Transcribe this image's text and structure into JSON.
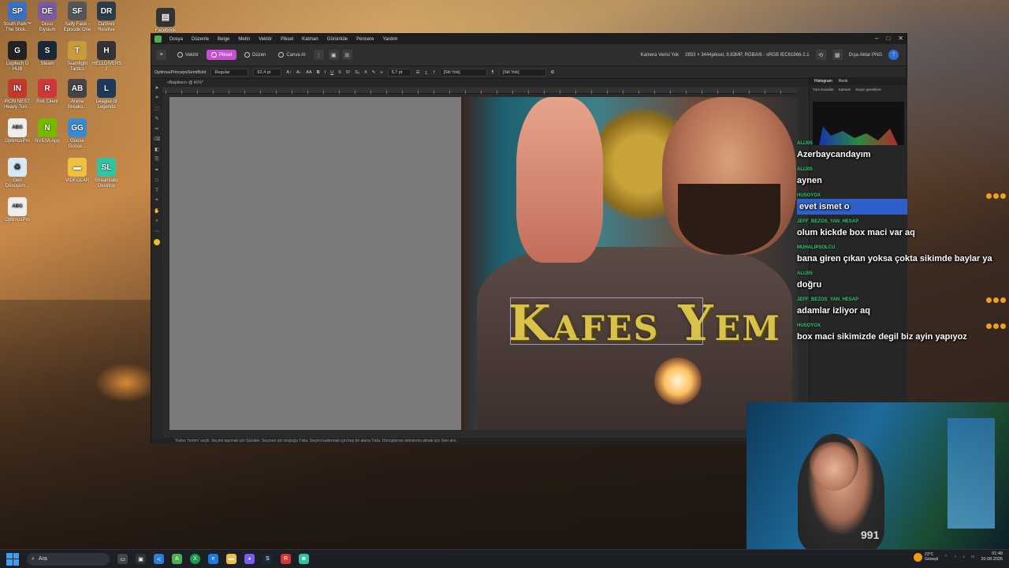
{
  "desktop": {
    "icons": [
      {
        "label": "South Park™ The Stick...",
        "glyph": "SP",
        "color": "#3b6fc0"
      },
      {
        "label": "Disco Elysium",
        "glyph": "DE",
        "color": "#7a5aa0"
      },
      {
        "label": "Sally Face - Episode One",
        "glyph": "SF",
        "color": "#555"
      },
      {
        "label": "DaVinci Resolve",
        "glyph": "DR",
        "color": "#2b3c4a"
      },
      {
        "label": "Logitech G HUB",
        "glyph": "G",
        "color": "#222"
      },
      {
        "label": "Steam",
        "glyph": "S",
        "color": "#1b2838"
      },
      {
        "label": "Teamfight Tactics",
        "glyph": "T",
        "color": "#c89b3c"
      },
      {
        "label": "HELLDIVERS 2",
        "glyph": "H",
        "color": "#333"
      },
      {
        "label": "IRON NEST: Heavy Turr...",
        "glyph": "IN",
        "color": "#c0392b"
      },
      {
        "label": "Riot Client",
        "glyph": "R",
        "color": "#d13639"
      },
      {
        "label": "Arena Breako...",
        "glyph": "AB",
        "color": "#444"
      },
      {
        "label": "League of Legends",
        "glyph": "L",
        "color": "#1e3a5a"
      },
      {
        "label": "OptimusPro",
        "glyph": "ABG",
        "color": "#eee"
      },
      {
        "label": "NVIDIA App",
        "glyph": "N",
        "color": "#76b900"
      },
      {
        "label": "Goose Goose...",
        "glyph": "GG",
        "color": "#3a8ad0"
      },
      {
        "label": "Geri Dönüşüm...",
        "glyph": "♻",
        "color": "#d6e9f5"
      },
      {
        "label": "VIDEOLAR",
        "glyph": "▬",
        "color": "#f0c040"
      },
      {
        "label": "Streamlabs Desktop",
        "glyph": "SL",
        "color": "#31c3a2"
      },
      {
        "label": "OptimusPro",
        "glyph": "ABG",
        "color": "#eee"
      }
    ],
    "top_file": "Facebook"
  },
  "app": {
    "menu": [
      "Dosya",
      "Düzenle",
      "Belge",
      "Metin",
      "Vektör",
      "Piksel",
      "Katman",
      "Görüntüle",
      "Pencere",
      "Yardım"
    ],
    "personas": [
      {
        "label": "Vektör",
        "active": false
      },
      {
        "label": "Piksel",
        "active": true
      },
      {
        "label": "Düzen",
        "active": false
      },
      {
        "label": "Canva AI",
        "active": false
      }
    ],
    "camera_label": "Kamera Verisi Yok",
    "doc_info": "2853 × 3444piksel, 9.83MP, RGBA/8 - sRGB IEC61966-2.1",
    "export_label": "Dışa Aktar PNG",
    "font_name": "OptimusPrincepsSemiBold",
    "font_style": "Regular",
    "font_size": "92,4 pt",
    "line_size": "5,7 pt",
    "style1": "[Stil Yok]",
    "style2": "[Stil Yok]",
    "doc_tab": "<Başlıksız> @ 41%*",
    "canvas_text": "Kafes Yem",
    "status": "'Kafes Yemini' seçili. Seçimi taşımak için Sürükle. Seçmek için boşluğa Tıkla. Seçimi kaldırmak için boş bir alana Tıkla. Dönüştürme dekolerini almak için Geri alın.",
    "panel_tabs": [
      "Histogram",
      "Renk"
    ],
    "panel_layer": "Tüm Kanallar",
    "panel_opts": [
      "Katman",
      "Seçim gereklere"
    ]
  },
  "chat": [
    {
      "user": "ALIJ05",
      "text": "Azerbaycandayım",
      "highlight": false,
      "badges": 0
    },
    {
      "user": "ALIJ05",
      "text": "aynen",
      "highlight": false,
      "badges": 0
    },
    {
      "user": "HUSOYOX",
      "text": "evet ismet o",
      "highlight": true,
      "badges": 3
    },
    {
      "user": "JEFF_BEZOS_YAN_HESAP",
      "text": "olum kickde box maci var aq",
      "highlight": false,
      "badges": 0
    },
    {
      "user": "MUHALIPSOLCU",
      "text": "bana giren çıkan yoksa çokta sikimde baylar ya",
      "highlight": false,
      "badges": 0
    },
    {
      "user": "ALIJ05",
      "text": "doğru",
      "highlight": false,
      "badges": 0
    },
    {
      "user": "JEFF_BEZOS_YAN_HESAP",
      "text": "adamlar izliyor aq",
      "highlight": false,
      "badges": 3
    },
    {
      "user": "HUSOYOX",
      "text": "box maci sikimizde degil biz ayin yapıyoz",
      "highlight": false,
      "badges": 3
    }
  ],
  "webcam": {
    "shirt_text": "991"
  },
  "taskbar": {
    "search_placeholder": "Ara",
    "weather_temp": "23°C",
    "weather_desc": "Güneşli",
    "time": "01:48",
    "date": "20.08.2026"
  }
}
